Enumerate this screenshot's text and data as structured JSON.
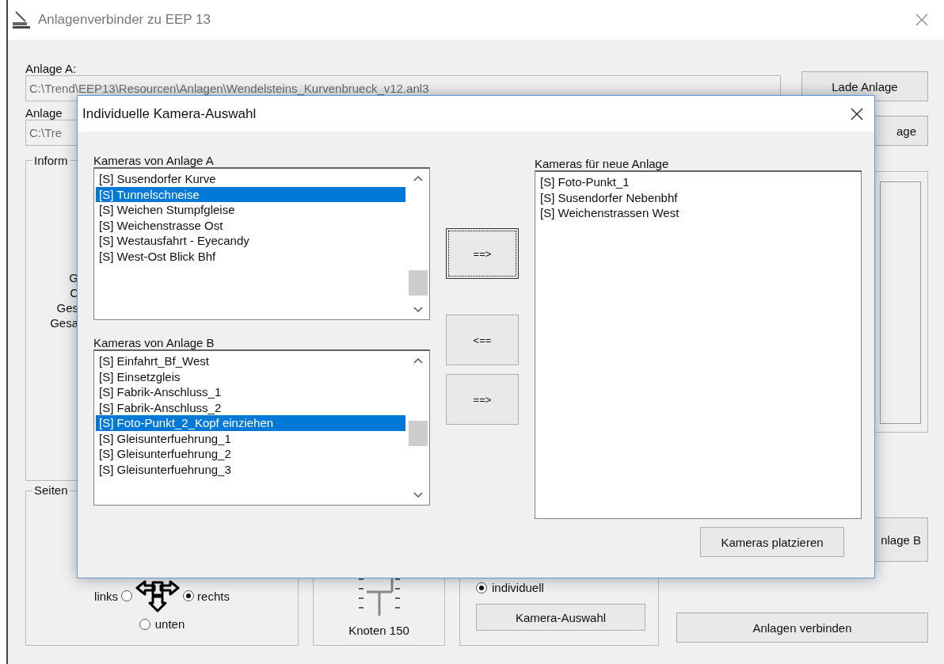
{
  "window": {
    "title": "Anlagenverbinder zu EEP 13"
  },
  "anlage_a": {
    "label": "Anlage A:",
    "path": "C:\\Trend\\EEP13\\Resourcen\\Anlagen\\Wendelsteins_Kurvenbrueck_v12.anl3",
    "button": "Lade Anlage"
  },
  "anlage_b": {
    "label": "Anlage",
    "path": "C:\\Tre",
    "button": "age"
  },
  "info_group": {
    "title": "Inform",
    "lines": [
      "G",
      "C",
      "Ges",
      "Gesa"
    ]
  },
  "side_group": {
    "title": "Seiten",
    "options": [
      {
        "label": "links",
        "selected": false
      },
      {
        "label": "rechts",
        "selected": true
      },
      {
        "label": "unten",
        "selected": false
      }
    ]
  },
  "node_group": {
    "label": "Knoten 150"
  },
  "camera_group": {
    "option": {
      "label": "individuell",
      "selected": true
    },
    "button": "Kamera-Auswahl"
  },
  "buttons": [
    "nlage B",
    "Anlagen verbinden"
  ],
  "dialog": {
    "title": "Individuelle Kamera-Auswahl",
    "list_a": {
      "label": "Kameras von Anlage A",
      "items": [
        {
          "text": "[S] Susendorfer Kurve",
          "selected": false
        },
        {
          "text": "[S] Tunnelschneise",
          "selected": true
        },
        {
          "text": "[S] Weichen Stumpfgleise",
          "selected": false
        },
        {
          "text": "[S] Weichenstrasse Ost",
          "selected": false
        },
        {
          "text": "[S] Westausfahrt - Eyecandy",
          "selected": false
        },
        {
          "text": "[S] West-Ost Blick Bhf",
          "selected": false
        }
      ]
    },
    "list_b": {
      "label": "Kameras von Anlage B",
      "items": [
        {
          "text": "[S] Einfahrt_Bf_West",
          "selected": false
        },
        {
          "text": "[S] Einsetzgleis",
          "selected": false
        },
        {
          "text": "[S] Fabrik-Anschluss_1",
          "selected": false
        },
        {
          "text": "[S] Fabrik-Anschluss_2",
          "selected": false
        },
        {
          "text": "[S] Foto-Punkt_2_Kopf einziehen",
          "selected": true
        },
        {
          "text": "[S] Gleisunterfuehrung_1",
          "selected": false
        },
        {
          "text": "[S] Gleisunterfuehrung_2",
          "selected": false
        },
        {
          "text": "[S] Gleisunterfuehrung_3",
          "selected": false
        }
      ]
    },
    "move_buttons": [
      {
        "label": "==>",
        "focused": true
      },
      {
        "label": "<==",
        "focused": false
      },
      {
        "label": "==>",
        "focused": false
      }
    ],
    "list_new": {
      "label": "Kameras für neue Anlage",
      "items": [
        {
          "text": "[S] Foto-Punkt_1",
          "selected": false
        },
        {
          "text": "[S] Susendorfer Nebenbhf",
          "selected": false
        },
        {
          "text": "[S] Weichenstrassen West",
          "selected": false
        }
      ]
    },
    "place_button": "Kameras platzieren"
  }
}
